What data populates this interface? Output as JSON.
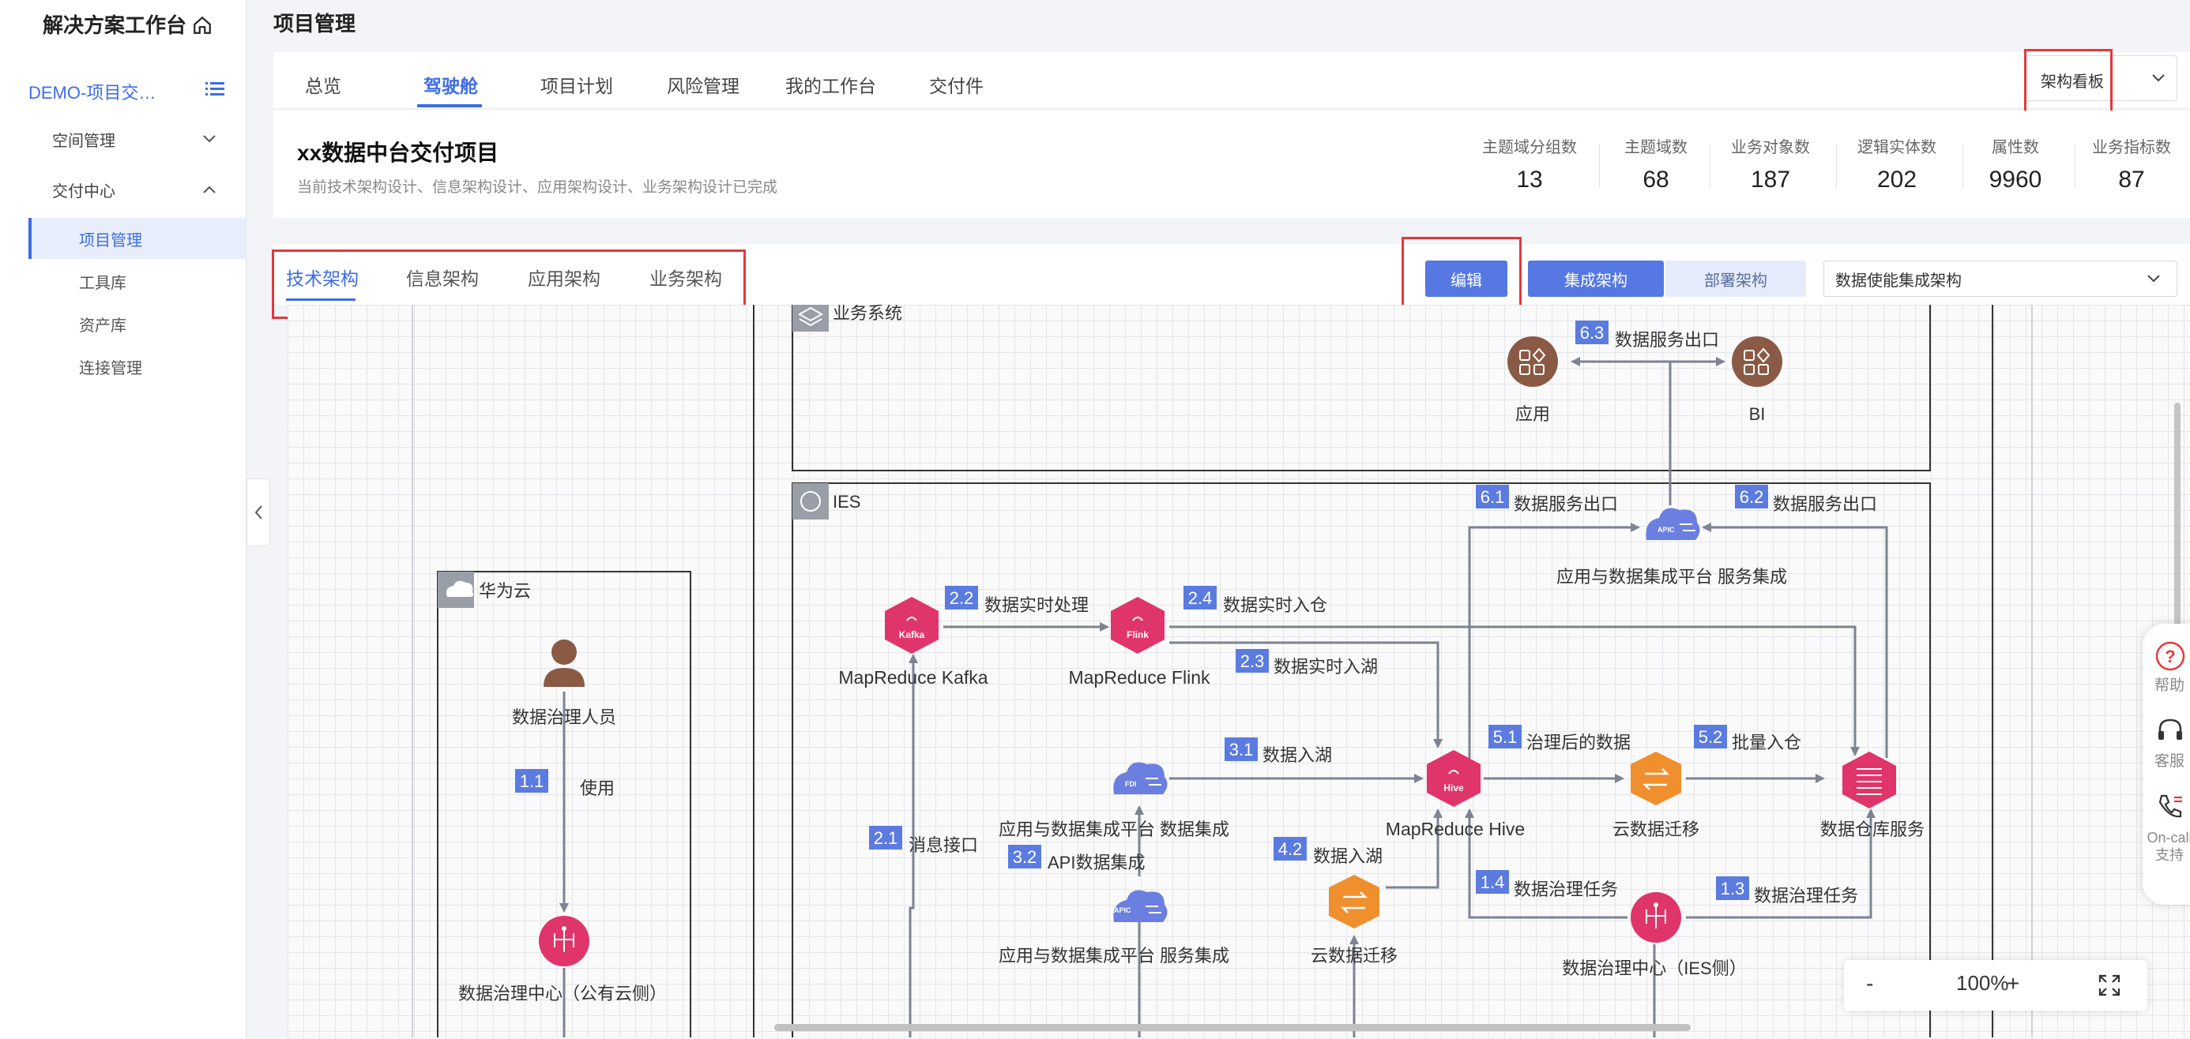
{
  "sidebar": {
    "brand": "解决方案工作台",
    "project": "DEMO-项目交…",
    "items": [
      {
        "label": "空间管理"
      },
      {
        "label": "交付中心"
      }
    ],
    "subitems": [
      {
        "label": "项目管理"
      },
      {
        "label": "工具库"
      },
      {
        "label": "资产库"
      },
      {
        "label": "连接管理"
      }
    ]
  },
  "header": {
    "title": "项目管理"
  },
  "tabs": [
    {
      "label": "总览"
    },
    {
      "label": "驾驶舱"
    },
    {
      "label": "项目计划"
    },
    {
      "label": "风险管理"
    },
    {
      "label": "我的工作台"
    },
    {
      "label": "交付件"
    }
  ],
  "active_tab": "驾驶舱",
  "view_select": {
    "value": "架构看板"
  },
  "project": {
    "name": "xx数据中台交付项目",
    "desc": "当前技术架构设计、信息架构设计、应用架构设计、业务架构设计已完成",
    "stats": [
      {
        "label": "主题域分组数",
        "value": "13"
      },
      {
        "label": "主题域数",
        "value": "68"
      },
      {
        "label": "业务对象数",
        "value": "187"
      },
      {
        "label": "逻辑实体数",
        "value": "202"
      },
      {
        "label": "属性数",
        "value": "9960"
      },
      {
        "label": "业务指标数",
        "value": "87"
      }
    ]
  },
  "arch_tabs": [
    {
      "label": "技术架构"
    },
    {
      "label": "信息架构"
    },
    {
      "label": "应用架构"
    },
    {
      "label": "业务架构"
    }
  ],
  "active_arch_tab": "技术架构",
  "toolbar": {
    "edit": "编辑",
    "integration": "集成架构",
    "deployment": "部署架构",
    "arch_select": "数据使能集成架构"
  },
  "diagram": {
    "containers": {
      "business_system": "业务系统",
      "ies": "IES",
      "huawei_cloud": "华为云"
    },
    "nodes": {
      "app": "应用",
      "bi": "BI",
      "apic_top": "应用与数据集成平台 服务集成",
      "kafka": "MapReduce Kafka",
      "kafka_badge": "Kafka",
      "flink": "MapReduce Flink",
      "flink_badge": "Flink",
      "fdi": "应用与数据集成平台 数据集成",
      "fdi_badge": "FDI",
      "hive": "MapReduce Hive",
      "hive_badge": "Hive",
      "migration_right": "云数据迁移",
      "warehouse": "数据仓库服务",
      "apic_bottom": "应用与数据集成平台 服务集成",
      "apic_badge": "APIC",
      "migration_bottom": "云数据迁移",
      "gov_ies": "数据治理中心（IES侧）",
      "person": "数据治理人员",
      "gov_cloud": "数据治理中心（公有云侧）"
    },
    "steps": [
      {
        "num": "6.3",
        "text": "数据服务出口"
      },
      {
        "num": "6.1",
        "text": "数据服务出口"
      },
      {
        "num": "6.2",
        "text": "数据服务出口"
      },
      {
        "num": "2.2",
        "text": "数据实时处理"
      },
      {
        "num": "2.4",
        "text": "数据实时入仓"
      },
      {
        "num": "2.3",
        "text": "数据实时入湖"
      },
      {
        "num": "3.1",
        "text": "数据入湖"
      },
      {
        "num": "5.1",
        "text": "治理后的数据"
      },
      {
        "num": "5.2",
        "text": "批量入仓"
      },
      {
        "num": "2.1",
        "text": "消息接口"
      },
      {
        "num": "3.2",
        "text": "API数据集成"
      },
      {
        "num": "4.2",
        "text": "数据入湖"
      },
      {
        "num": "1.4",
        "text": "数据治理任务"
      },
      {
        "num": "1.3",
        "text": "数据治理任务"
      },
      {
        "num": "1.1",
        "text": "使用"
      }
    ]
  },
  "zoom": {
    "minus": "-",
    "level": "100%",
    "plus": "+"
  },
  "dock": {
    "help": "帮助",
    "service": "客服",
    "oncall": "On-call支持"
  },
  "colors": {
    "accent": "#3e6ce4",
    "badge": "#5b7be0",
    "node_pink": "#e0356a",
    "node_orange": "#ef8f2e",
    "node_brown": "#8a5a44",
    "node_purple": "#6b7fe0",
    "highlight": "#e4383b"
  }
}
